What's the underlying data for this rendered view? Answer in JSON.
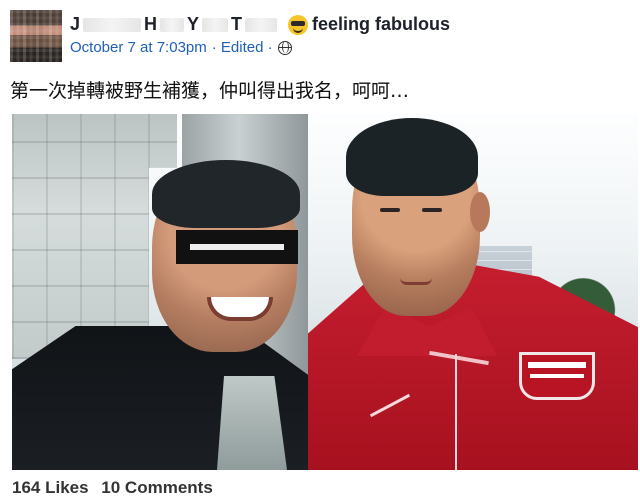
{
  "post": {
    "author_initials": [
      "J",
      "H",
      "Y",
      "T"
    ],
    "feeling_text": "feeling fabulous",
    "date_text": "October 7 at 7:03pm",
    "edited_text": "· Edited ·",
    "status_text": "第一次掉轉被野生補獲，仲叫得出我名，呵呵…"
  },
  "footer": {
    "likes_text": "164 Likes",
    "comments_text": "10 Comments"
  },
  "icons": {
    "avatar": "avatar",
    "feeling": "sunglasses-emoji-icon",
    "privacy": "globe-icon"
  }
}
